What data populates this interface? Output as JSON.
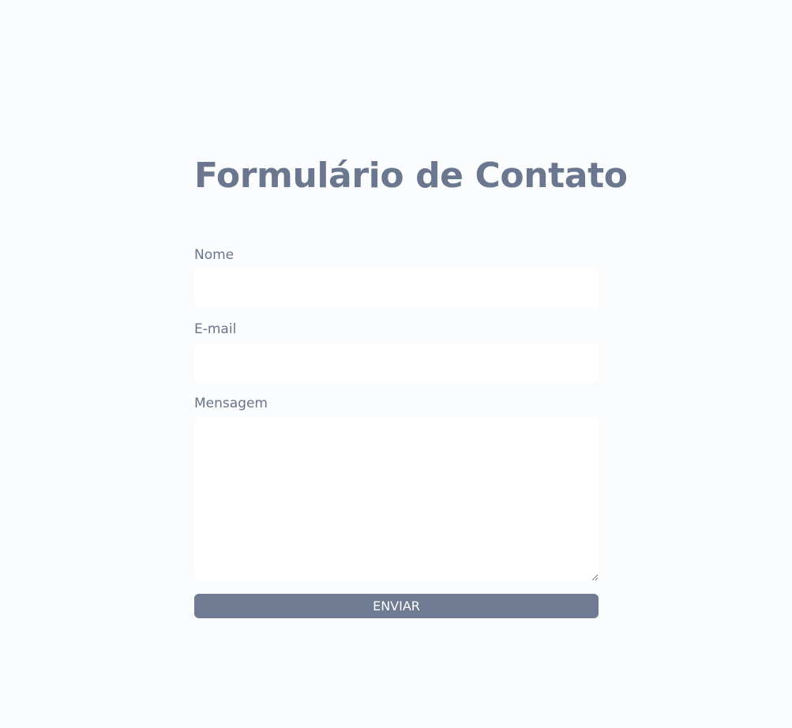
{
  "form": {
    "title": "Formulário de Contato",
    "fields": {
      "name": {
        "label": "Nome",
        "value": ""
      },
      "email": {
        "label": "E-mail",
        "value": ""
      },
      "message": {
        "label": "Mensagem",
        "value": ""
      }
    },
    "submit_label": "ENVIAR"
  },
  "colors": {
    "background": "#fbfcfe",
    "title": "#6b778f",
    "label": "#697489",
    "field_background": "#ffffff",
    "button_background": "#6e7b93",
    "button_text": "#ffffff"
  }
}
